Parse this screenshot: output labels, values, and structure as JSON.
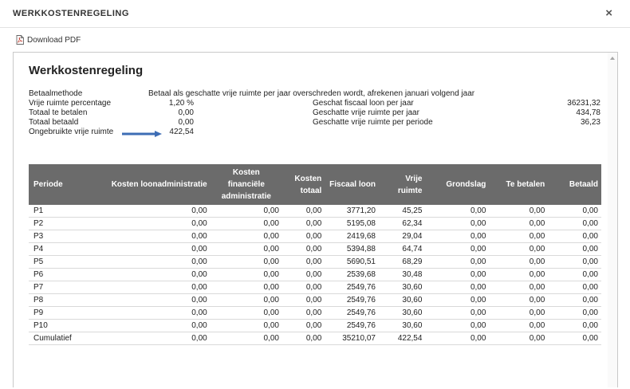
{
  "header": {
    "title": "WERKKOSTENREGELING",
    "close_label": "×"
  },
  "toolbar": {
    "download_label": "Download PDF"
  },
  "document": {
    "title": "Werkkostenregeling",
    "betaalmethode_label": "Betaalmethode",
    "betaalmethode_value": "Betaal als geschatte vrije ruimte per jaar overschreden wordt, afrekenen januari volgend jaar",
    "vrije_ruimte_pct_label": "Vrije ruimte percentage",
    "vrije_ruimte_pct_value": "1,20 %",
    "totaal_te_betalen_label": "Totaal te betalen",
    "totaal_te_betalen_value": "0,00",
    "totaal_betaald_label": "Totaal betaald",
    "totaal_betaald_value": "0,00",
    "ongebruikte_label": "Ongebruikte vrije ruimte",
    "ongebruikte_value": "422,54",
    "fiscaal_loon_label": "Geschat fiscaal loon per jaar",
    "fiscaal_loon_value": "36231,32",
    "vrije_ruimte_jaar_label": "Geschatte vrije ruimte per jaar",
    "vrije_ruimte_jaar_value": "434,78",
    "vrije_ruimte_periode_label": "Geschatte vrije ruimte per periode",
    "vrije_ruimte_periode_value": "36,23",
    "arrow_color": "#3d6db5"
  },
  "table": {
    "header_bg": "#6b6b6b",
    "columns": [
      "Periode",
      "Kosten loonadministratie",
      "Kosten financiële administratie",
      "Kosten totaal",
      "Fiscaal loon",
      "Vrije ruimte",
      "Grondslag",
      "Te betalen",
      "Betaald"
    ],
    "rows": [
      [
        "P1",
        "0,00",
        "0,00",
        "0,00",
        "3771,20",
        "45,25",
        "0,00",
        "0,00",
        "0,00"
      ],
      [
        "P2",
        "0,00",
        "0,00",
        "0,00",
        "5195,08",
        "62,34",
        "0,00",
        "0,00",
        "0,00"
      ],
      [
        "P3",
        "0,00",
        "0,00",
        "0,00",
        "2419,68",
        "29,04",
        "0,00",
        "0,00",
        "0,00"
      ],
      [
        "P4",
        "0,00",
        "0,00",
        "0,00",
        "5394,88",
        "64,74",
        "0,00",
        "0,00",
        "0,00"
      ],
      [
        "P5",
        "0,00",
        "0,00",
        "0,00",
        "5690,51",
        "68,29",
        "0,00",
        "0,00",
        "0,00"
      ],
      [
        "P6",
        "0,00",
        "0,00",
        "0,00",
        "2539,68",
        "30,48",
        "0,00",
        "0,00",
        "0,00"
      ],
      [
        "P7",
        "0,00",
        "0,00",
        "0,00",
        "2549,76",
        "30,60",
        "0,00",
        "0,00",
        "0,00"
      ],
      [
        "P8",
        "0,00",
        "0,00",
        "0,00",
        "2549,76",
        "30,60",
        "0,00",
        "0,00",
        "0,00"
      ],
      [
        "P9",
        "0,00",
        "0,00",
        "0,00",
        "2549,76",
        "30,60",
        "0,00",
        "0,00",
        "0,00"
      ],
      [
        "P10",
        "0,00",
        "0,00",
        "0,00",
        "2549,76",
        "30,60",
        "0,00",
        "0,00",
        "0,00"
      ],
      [
        "Cumulatief",
        "0,00",
        "0,00",
        "0,00",
        "35210,07",
        "422,54",
        "0,00",
        "0,00",
        "0,00"
      ]
    ]
  }
}
